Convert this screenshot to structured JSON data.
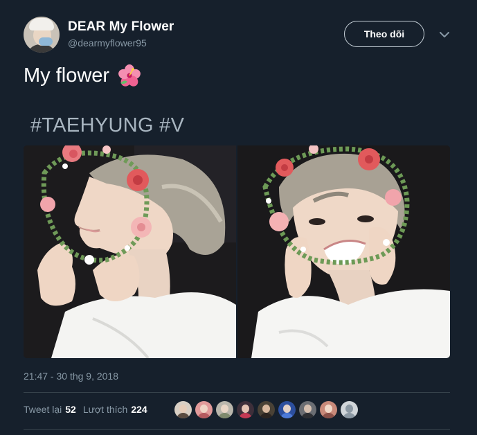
{
  "user": {
    "display_name": "DEAR My Flower",
    "handle": "@dearmyflower95",
    "avatar_icon": "profile-avatar"
  },
  "header": {
    "follow_label": "Theo dõi",
    "menu_icon": "chevron-down-icon"
  },
  "tweet": {
    "text": "My flower",
    "emoji": "hibiscus-emoji",
    "hashtags": "#TAEHYUNG #V"
  },
  "media": {
    "photo_count": 2
  },
  "footer": {
    "timestamp": "21:47 - 30 thg 9, 2018",
    "retweet_label": "Tweet lại",
    "retweet_count": "52",
    "like_label": "Lượt thích",
    "like_count": "224",
    "liker_avatars": 9
  },
  "colors": {
    "background": "#16202c",
    "secondary_text": "#8899a6",
    "hashtag_text": "#a8b5c0",
    "divider": "#38444d"
  }
}
